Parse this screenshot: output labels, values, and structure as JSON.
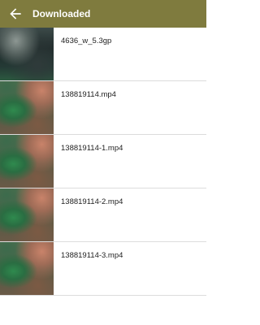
{
  "appbar": {
    "title": "Downloaded",
    "back_icon": "arrow-left-icon",
    "background_color": "#7f7b3e"
  },
  "files": [
    {
      "name": "4636_w_5.3gp"
    },
    {
      "name": "138819114.mp4"
    },
    {
      "name": "138819114-1.mp4"
    },
    {
      "name": "138819114-2.mp4"
    },
    {
      "name": "138819114-3.mp4"
    }
  ]
}
